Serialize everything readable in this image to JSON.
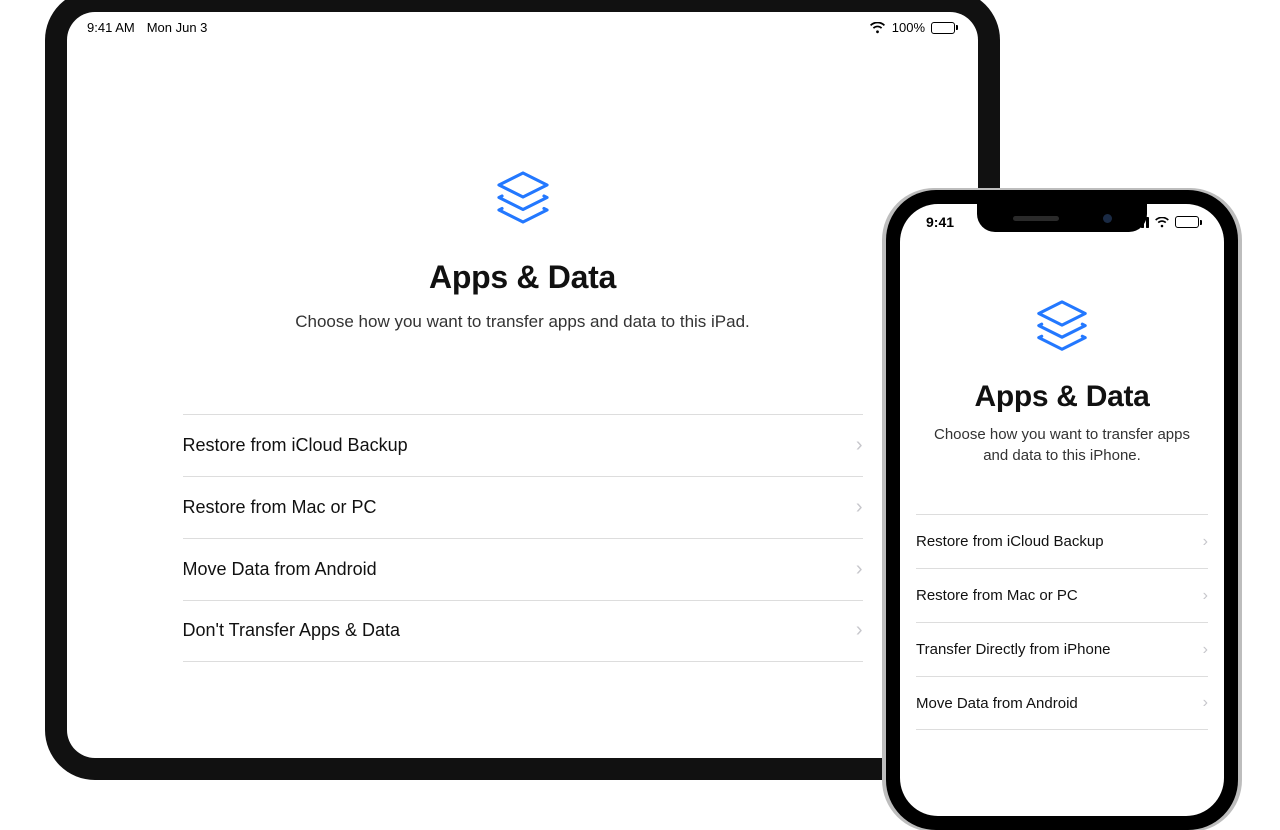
{
  "ipad": {
    "status": {
      "time": "9:41 AM",
      "date": "Mon Jun 3",
      "battery_pct": "100%"
    },
    "title": "Apps & Data",
    "subtitle": "Choose how you want to transfer apps and data to this iPad.",
    "options": [
      {
        "label": "Restore from iCloud Backup"
      },
      {
        "label": "Restore from Mac or PC"
      },
      {
        "label": "Move Data from Android"
      },
      {
        "label": "Don't Transfer Apps & Data"
      }
    ]
  },
  "iphone": {
    "status": {
      "time": "9:41"
    },
    "title": "Apps & Data",
    "subtitle": "Choose how you want to transfer apps and data to this iPhone.",
    "options": [
      {
        "label": "Restore from iCloud Backup"
      },
      {
        "label": "Restore from Mac or PC"
      },
      {
        "label": "Transfer Directly from iPhone"
      },
      {
        "label": "Move Data from Android"
      }
    ]
  },
  "colors": {
    "accent": "#2378ff"
  }
}
